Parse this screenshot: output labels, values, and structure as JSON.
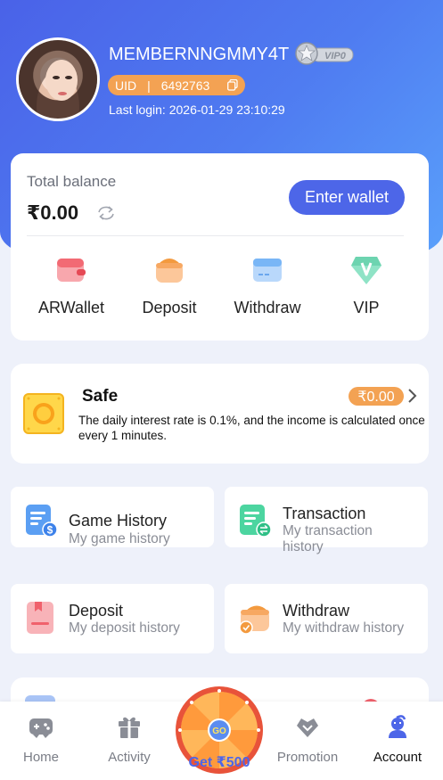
{
  "profile": {
    "username": "MEMBERNNGMMY4T",
    "vip_level": "VIP0",
    "uid_label": "UID",
    "uid_separator": "|",
    "uid_value": "6492763",
    "last_login": "Last login: 2026-01-29 23:10:29"
  },
  "balance": {
    "label": "Total balance",
    "amount": "₹0.00",
    "enter_wallet_label": "Enter wallet"
  },
  "shortcuts": [
    {
      "label": "ARWallet",
      "icon": "arwallet-icon"
    },
    {
      "label": "Deposit",
      "icon": "deposit-icon"
    },
    {
      "label": "Withdraw",
      "icon": "withdraw-card-icon"
    },
    {
      "label": "VIP",
      "icon": "vip-gem-icon"
    }
  ],
  "safe": {
    "title": "Safe",
    "amount": "₹0.00",
    "description": "The daily interest rate is 0.1%, and the income is calculated once every 1 minutes."
  },
  "history": [
    {
      "title": "Game History",
      "subtitle": "My game history",
      "icon": "game-history-icon"
    },
    {
      "title": "Transaction",
      "subtitle": "My transaction history",
      "icon": "transaction-icon"
    },
    {
      "title": "Deposit",
      "subtitle": "My deposit history",
      "icon": "deposit-history-icon"
    },
    {
      "title": "Withdraw",
      "subtitle": "My withdraw history",
      "icon": "withdraw-history-icon"
    }
  ],
  "tabbar": {
    "home": "Home",
    "activity": "Activity",
    "wheel_label": "Get ₹500",
    "wheel_button": "GO",
    "promotion": "Promotion",
    "account": "Account"
  },
  "colors": {
    "accent": "#4d66e8",
    "orange": "#f3a253",
    "background": "#eef1fa"
  }
}
